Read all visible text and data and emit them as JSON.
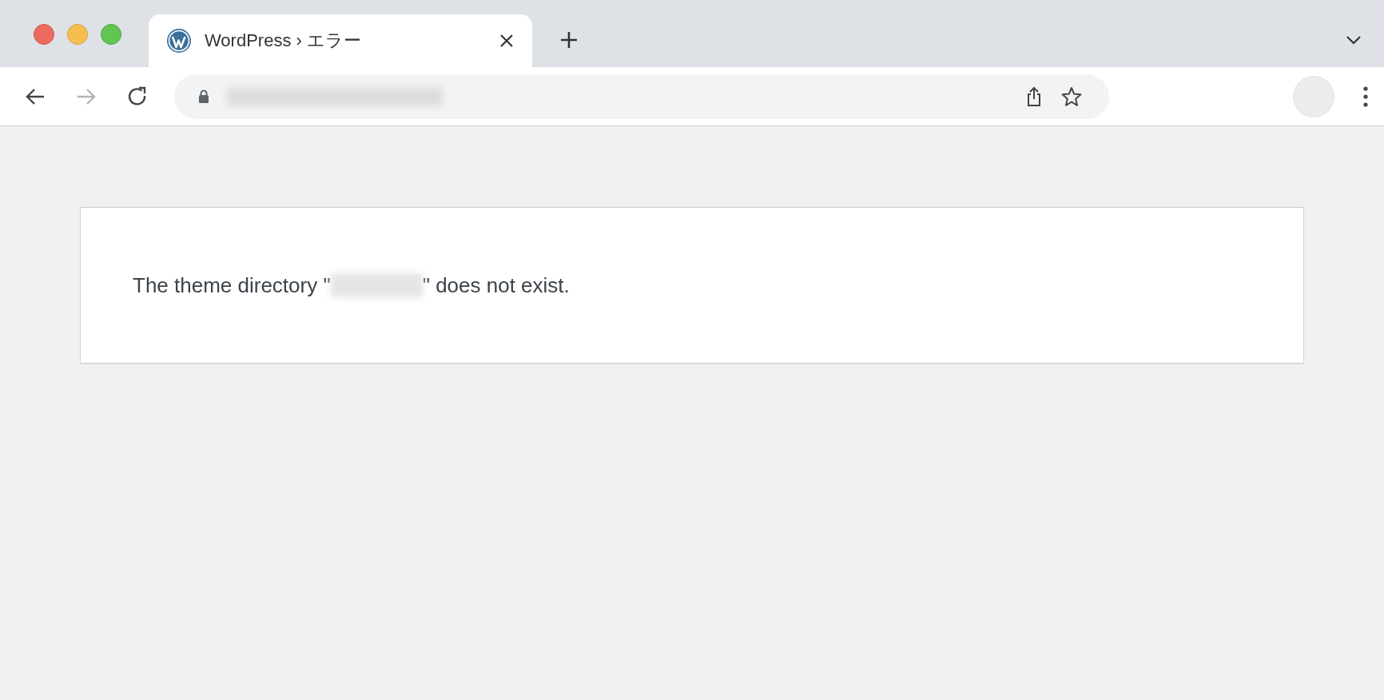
{
  "tabs": [
    {
      "title": "WordPress › エラー",
      "selected": true
    }
  ],
  "toolbar": {
    "back": {
      "disabled": false
    },
    "forward": {
      "disabled": true
    }
  },
  "message": {
    "before": "The theme directory \"",
    "after": "\" does not exist."
  }
}
